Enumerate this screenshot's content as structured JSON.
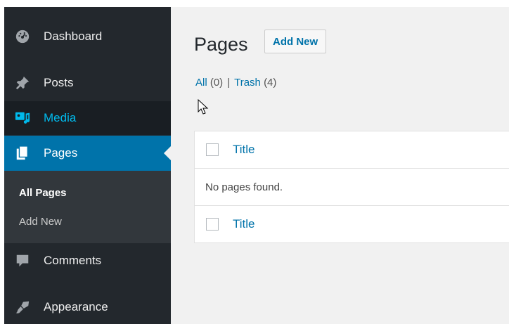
{
  "sidebar": {
    "items": [
      {
        "label": "Dashboard",
        "icon": "dashboard-icon"
      },
      {
        "label": "Posts",
        "icon": "pin-icon"
      },
      {
        "label": "Media",
        "icon": "media-icon"
      },
      {
        "label": "Pages",
        "icon": "pages-icon"
      },
      {
        "label": "Comments",
        "icon": "comment-icon"
      },
      {
        "label": "Appearance",
        "icon": "brush-icon"
      }
    ],
    "submenu": [
      {
        "label": "All Pages"
      },
      {
        "label": "Add New"
      }
    ]
  },
  "main": {
    "title": "Pages",
    "add_new_label": "Add New",
    "views": {
      "all_label": "All",
      "all_count": "(0)",
      "separator": "|",
      "trash_label": "Trash",
      "trash_count": "(4)"
    },
    "table": {
      "header_title": "Title",
      "empty_message": "No pages found.",
      "footer_title": "Title"
    }
  },
  "colors": {
    "sidebar_bg": "#23282d",
    "active_bg": "#0073aa",
    "link": "#0073aa",
    "media_highlight": "#00b9eb"
  }
}
